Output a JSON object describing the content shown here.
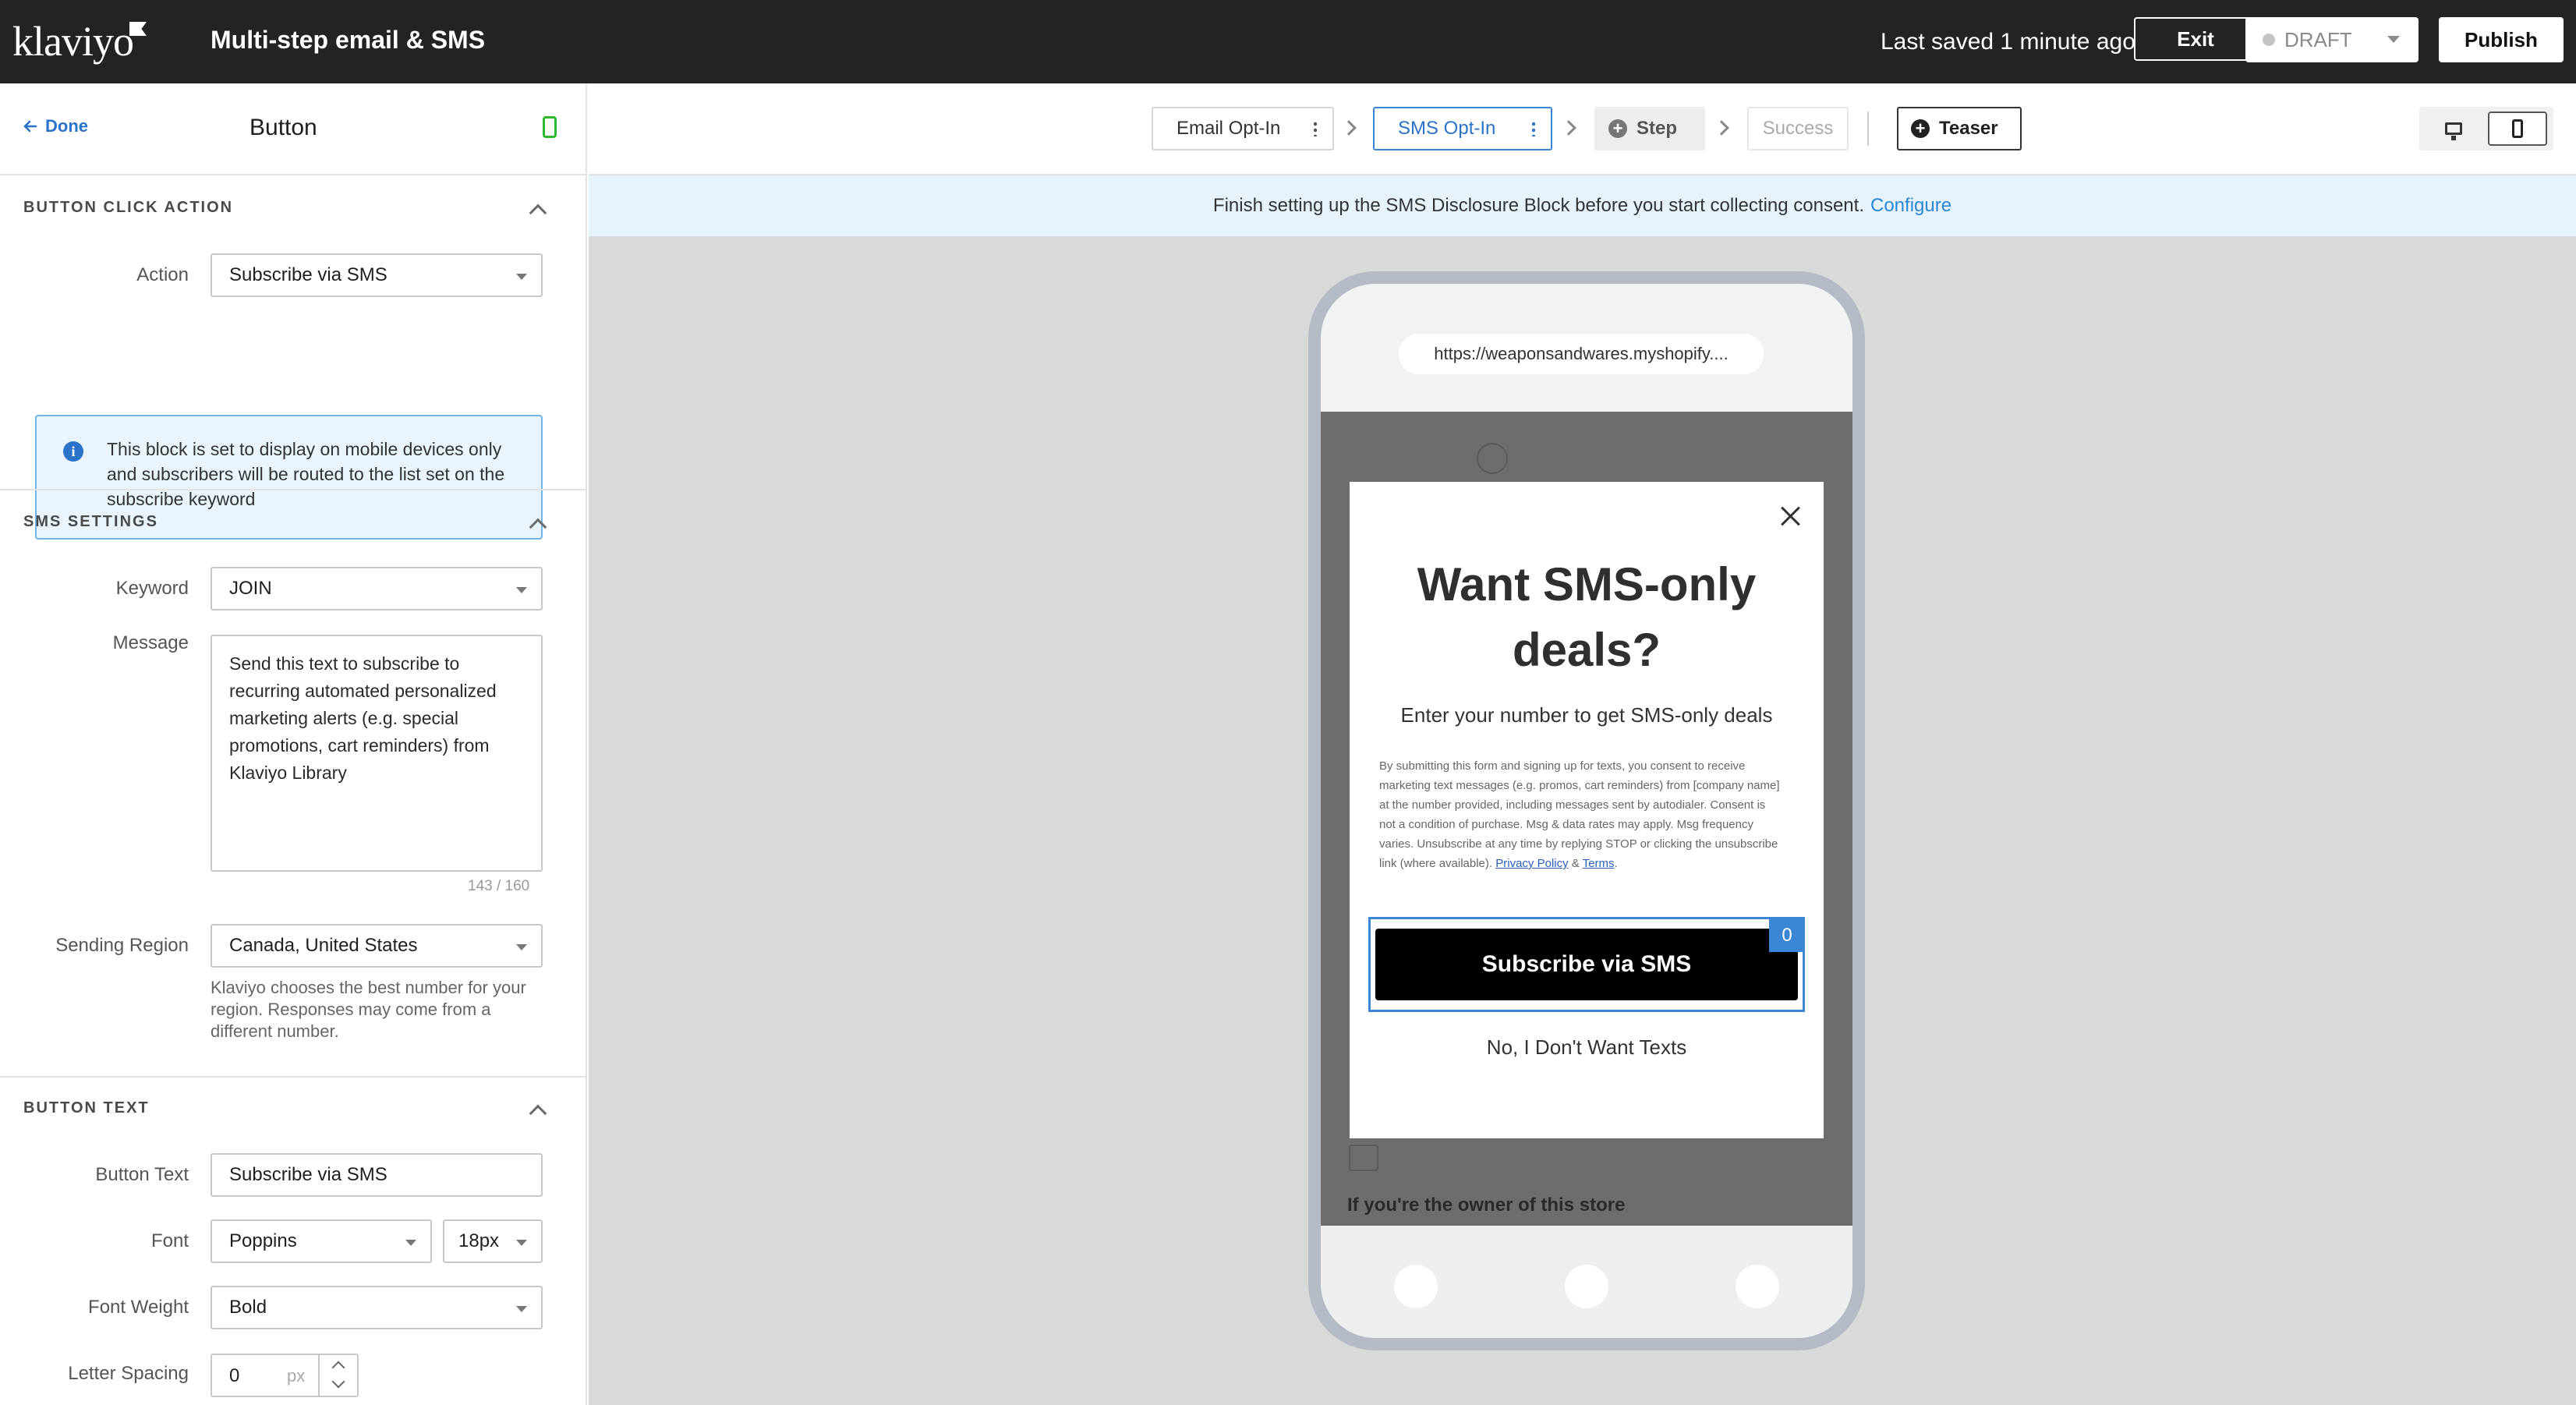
{
  "topbar": {
    "logo": "klaviyo",
    "title": "Multi-step email & SMS",
    "last_saved": "Last saved 1 minute ago",
    "exit_label": "Exit",
    "status_label": "DRAFT",
    "publish_label": "Publish"
  },
  "panel": {
    "done_label": "Done",
    "title": "Button",
    "sections": {
      "click_action": {
        "title": "BUTTON CLICK ACTION",
        "action_label": "Action",
        "action_value": "Subscribe via SMS",
        "info_text": "This block is set to display on mobile devices only and subscribers will be routed to the list set on the subscribe keyword"
      },
      "sms_settings": {
        "title": "SMS SETTINGS",
        "keyword_label": "Keyword",
        "keyword_value": "JOIN",
        "message_label": "Message",
        "message_value": "Send this text to subscribe to recurring automated personalized marketing alerts (e.g. special promotions, cart reminders) from Klaviyo Library",
        "char_count": "143 / 160",
        "region_label": "Sending Region",
        "region_value": "Canada, United States",
        "region_help": "Klaviyo chooses the best number for your region. Responses may come from a different number."
      },
      "button_text": {
        "title": "BUTTON TEXT",
        "text_label": "Button Text",
        "text_value": "Subscribe via SMS",
        "font_label": "Font",
        "font_value": "Poppins",
        "size_value": "18px",
        "weight_label": "Font Weight",
        "weight_value": "Bold",
        "spacing_label": "Letter Spacing",
        "spacing_value": "0",
        "spacing_unit": "px"
      }
    }
  },
  "steps": {
    "tabs": [
      {
        "label": "Email Opt-In",
        "active": false
      },
      {
        "label": "SMS Opt-In",
        "active": true
      }
    ],
    "add_step_label": "Step",
    "success_label": "Success",
    "teaser_label": "Teaser"
  },
  "banner": {
    "text": "Finish setting up the SMS Disclosure Block before you start collecting consent.",
    "link": "Configure"
  },
  "preview": {
    "url": "https://weaponsandwares.myshopify....",
    "heading": "Want SMS-only deals?",
    "subheading": "Enter your number to get SMS-only deals",
    "legal_text": "By submitting this form and signing up for texts, you consent to receive marketing text messages (e.g. promos, cart reminders) from [company name] at the number provided, including messages sent by autodialer. Consent is not a condition of purchase. Msg & data rates may apply. Msg frequency varies. Unsubscribe at any time by replying STOP or clicking the unsubscribe link (where available).",
    "privacy_link": "Privacy Policy",
    "amp": "&",
    "terms_link": "Terms",
    "period": ".",
    "cta_label": "Subscribe via SMS",
    "cta_badge": "0",
    "decline_label": "No, I Don't Want Texts",
    "store_text": "If you're the owner of this store"
  },
  "colors": {
    "topbar": "#232323",
    "accent_blue": "#3b87d6",
    "link_blue": "#2a73c8",
    "canvas": "#d9d9d9",
    "banner": "#e6f3fc",
    "mobile_indicator": "#2eb82e"
  }
}
